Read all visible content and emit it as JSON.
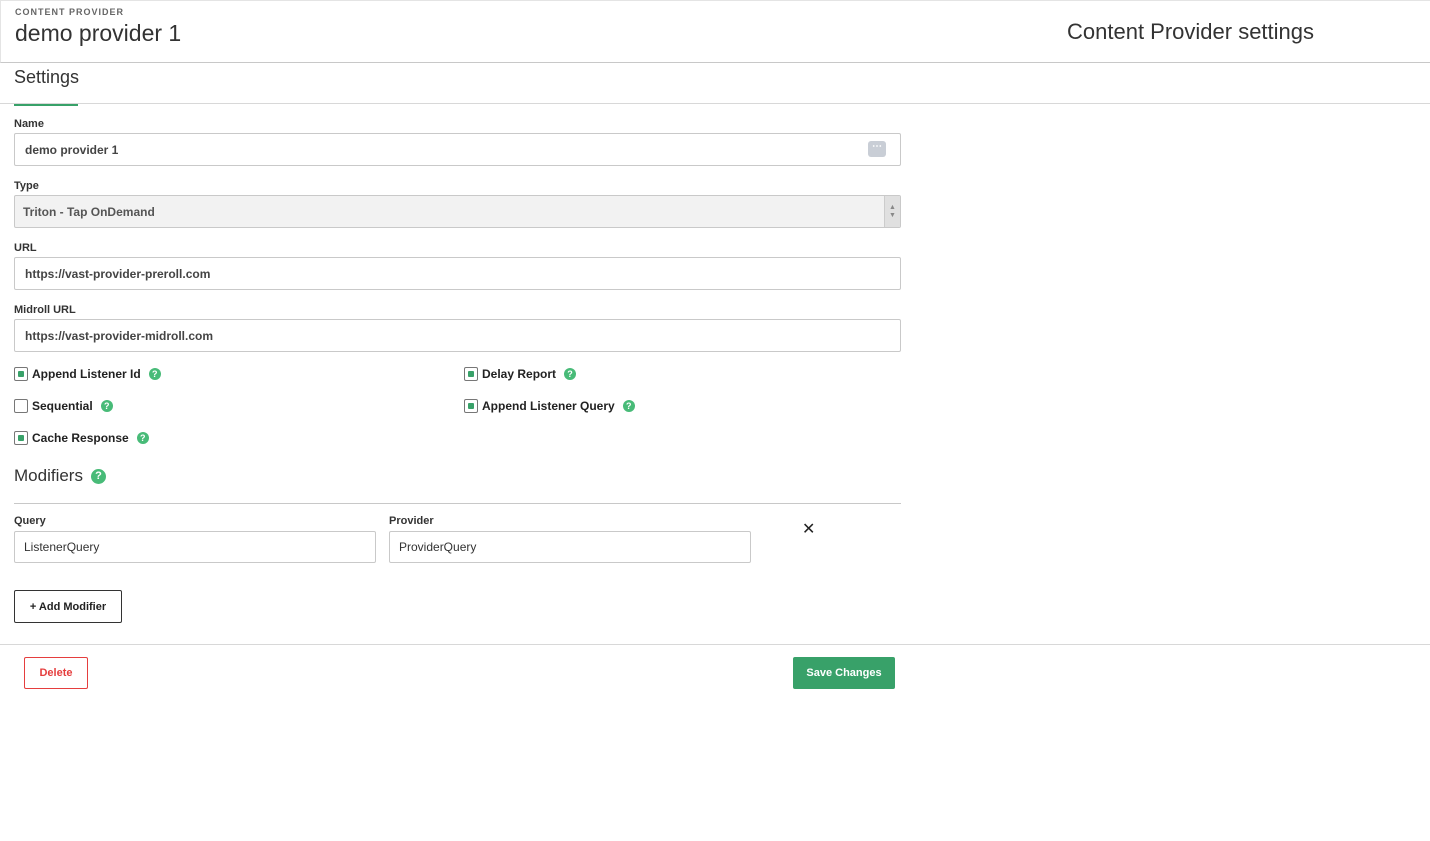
{
  "header": {
    "eyebrow": "CONTENT PROVIDER",
    "title": "demo provider 1",
    "right_title": "Content Provider settings"
  },
  "tabs": [
    {
      "label": "Settings",
      "active": true
    }
  ],
  "form": {
    "name": {
      "label": "Name",
      "value": "demo provider 1"
    },
    "type": {
      "label": "Type",
      "value": "Triton - Tap OnDemand"
    },
    "url": {
      "label": "URL",
      "value": "https://vast-provider-preroll.com"
    },
    "midroll_url": {
      "label": "Midroll URL",
      "value": "https://vast-provider-midroll.com"
    }
  },
  "checkboxes": {
    "append_listener_id": {
      "label": "Append Listener Id",
      "checked": true
    },
    "delay_report": {
      "label": "Delay Report",
      "checked": true
    },
    "sequential": {
      "label": "Sequential",
      "checked": false
    },
    "append_listener_query": {
      "label": "Append Listener Query",
      "checked": true
    },
    "cache_response": {
      "label": "Cache Response",
      "checked": true
    }
  },
  "modifiers": {
    "title": "Modifiers",
    "query_label": "Query",
    "provider_label": "Provider",
    "rows": [
      {
        "query": "ListenerQuery",
        "provider": "ProviderQuery"
      }
    ],
    "add_label": "+ Add Modifier"
  },
  "footer": {
    "delete_label": "Delete",
    "save_label": "Save Changes"
  },
  "icons": {
    "help": "help-circle-icon",
    "close": "close-icon",
    "more": "ellipsis-icon",
    "select_arrows": "sort-arrows-icon"
  },
  "colors": {
    "accent": "#38a169",
    "danger": "#e53e3e",
    "help": "#48bb78"
  }
}
